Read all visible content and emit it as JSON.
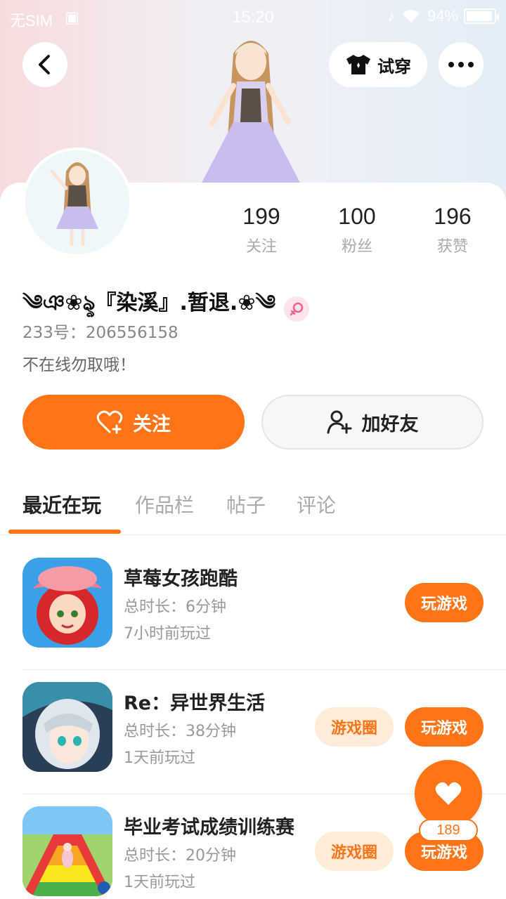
{
  "status_bar": {
    "carrier": "无SIM",
    "time": "15:20",
    "battery": "94%"
  },
  "header": {
    "try_on_label": "试穿"
  },
  "stats": [
    {
      "value": "199",
      "label": "关注"
    },
    {
      "value": "100",
      "label": "粉丝"
    },
    {
      "value": "196",
      "label": "获赞"
    }
  ],
  "profile": {
    "nickname": "༄ঞ❀ৡ『染溪』.暂退.❀༄",
    "uid": "233号：206556158",
    "bio": "不在线勿取哦！"
  },
  "actions": {
    "follow_label": "关注",
    "add_friend_label": "加好友"
  },
  "tabs": [
    "最近在玩",
    "作品栏",
    "帖子",
    "评论"
  ],
  "games": [
    {
      "title": "草莓女孩跑酷",
      "duration": "总时长：6分钟",
      "last_played": "7小时前玩过",
      "circle_label": "",
      "play_label": "玩游戏"
    },
    {
      "title": "Re：异世界生活",
      "duration": "总时长：38分钟",
      "last_played": "1天前玩过",
      "circle_label": "游戏圈",
      "play_label": "玩游戏"
    },
    {
      "title": "毕业考试成绩训练赛",
      "duration": "总时长：20分钟",
      "last_played": "1天前玩过",
      "circle_label": "游戏圈",
      "play_label": "玩游戏"
    }
  ],
  "floating_like": {
    "count": "189"
  },
  "colors": {
    "accent": "#ff7417",
    "accent_light": "#ffebd9"
  }
}
